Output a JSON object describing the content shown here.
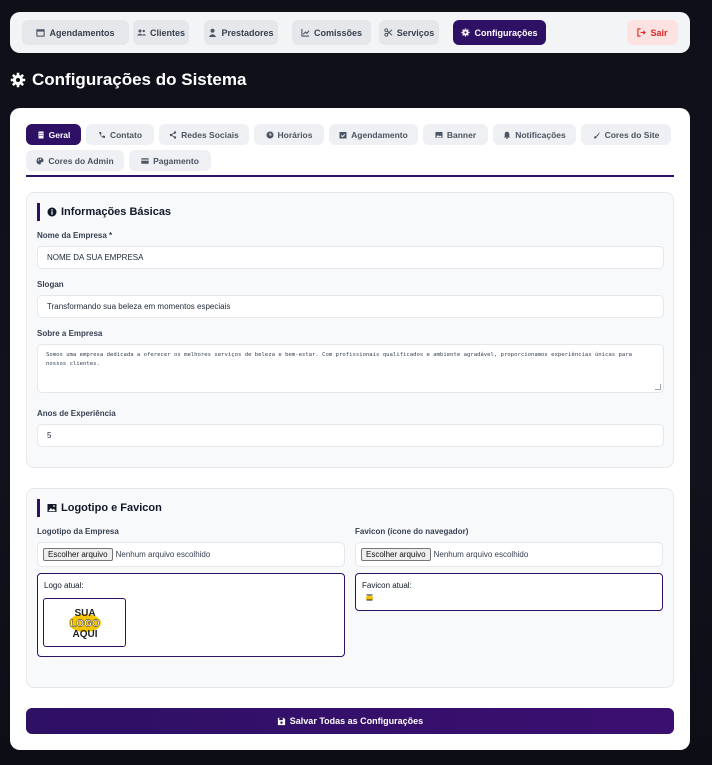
{
  "nav": {
    "items": [
      {
        "label": "Agendamentos",
        "icon": "calendar-icon"
      },
      {
        "label": "Clientes",
        "icon": "users-icon"
      },
      {
        "label": "Prestadores",
        "icon": "user-icon"
      },
      {
        "label": "Comissões",
        "icon": "chart-line-icon"
      },
      {
        "label": "Serviços",
        "icon": "scissors-icon"
      },
      {
        "label": "Configurações",
        "icon": "gear-icon",
        "active": true
      }
    ],
    "logout_label": "Sair"
  },
  "page": {
    "title": "Configurações do Sistema"
  },
  "tabs": [
    {
      "label": "Geral",
      "active": true
    },
    {
      "label": "Contato"
    },
    {
      "label": "Redes Sociais"
    },
    {
      "label": "Horários"
    },
    {
      "label": "Agendamento"
    },
    {
      "label": "Banner"
    },
    {
      "label": "Notificações"
    },
    {
      "label": "Cores do Site"
    },
    {
      "label": "Cores do Admin"
    },
    {
      "label": "Pagamento"
    }
  ],
  "basic_info": {
    "title": "Informações Básicas",
    "company_name_label": "Nome da Empresa *",
    "company_name_value": "NOME DA SUA EMPRESA",
    "slogan_label": "Slogan",
    "slogan_value": "Transformando sua beleza em momentos especiais",
    "about_label": "Sobre a Empresa",
    "about_value": "Somos uma empresa dedicada a oferecer os melhores serviços de beleza e bem-estar. Com profissionais qualificados e ambiente agradável, proporcionamos experiências únicas para nossos clientes.",
    "experience_label": "Anos de Experiência",
    "experience_value": "5"
  },
  "logo_section": {
    "title": "Logotipo e Favicon",
    "logo_label": "Logotipo da Empresa",
    "favicon_label": "Favicon (ícone do navegador)",
    "file_button": "Escolher arquivo",
    "no_file": "Nenhum arquivo escolhido",
    "current_logo_label": "Logo atual:",
    "current_favicon_label": "Favicon atual:",
    "logo_text": [
      "SUA",
      "LOGO",
      "AQUI"
    ]
  },
  "save_button": "Salvar Todas as Configurações",
  "colors": {
    "primary": "#2e1065",
    "danger": "#dc2626",
    "logo_yellow": "#f5c400"
  }
}
